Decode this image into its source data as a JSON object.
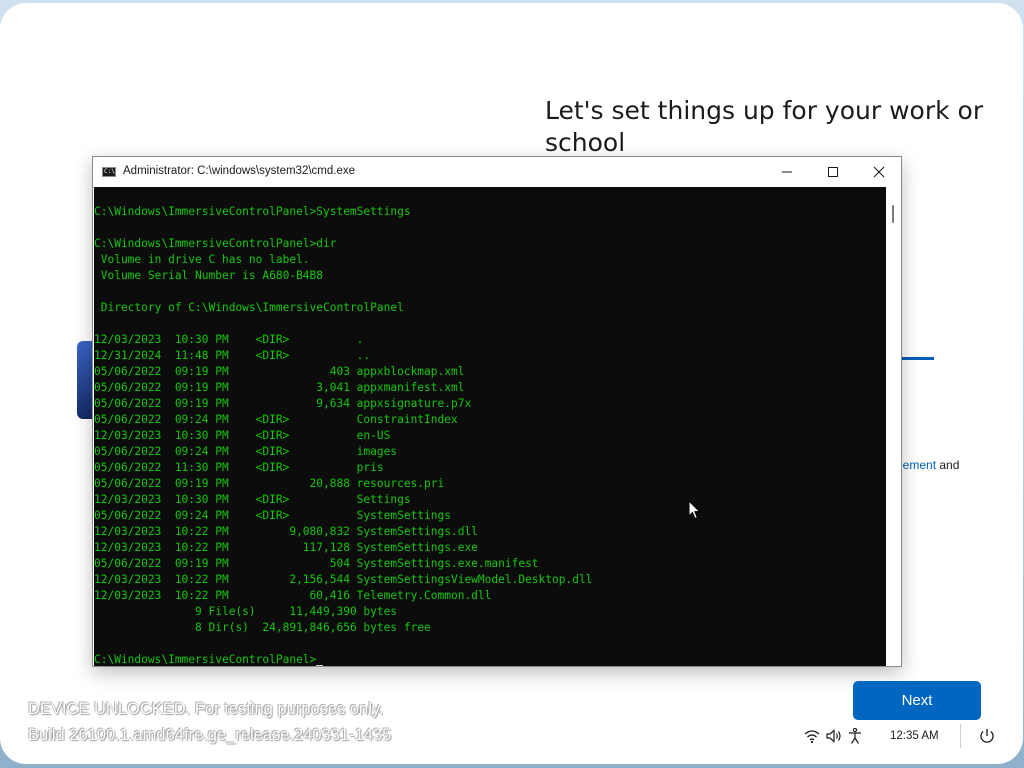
{
  "oobe": {
    "title": "Let's set things up for your work or school",
    "link_fragment_link": "eement",
    "link_fragment_text": " and",
    "next_label": "Next"
  },
  "cmd": {
    "title": "Administrator: C:\\windows\\system32\\cmd.exe",
    "icon_text": "C:\\",
    "lines": [
      "C:\\Windows\\ImmersiveControlPanel>SystemSettings",
      "",
      "C:\\Windows\\ImmersiveControlPanel>dir",
      " Volume in drive C has no label.",
      " Volume Serial Number is A680-B4B8",
      "",
      " Directory of C:\\Windows\\ImmersiveControlPanel",
      "",
      "12/03/2023  10:30 PM    <DIR>          .",
      "12/31/2024  11:48 PM    <DIR>          ..",
      "05/06/2022  09:19 PM               403 appxblockmap.xml",
      "05/06/2022  09:19 PM             3,041 appxmanifest.xml",
      "05/06/2022  09:19 PM             9,634 appxsignature.p7x",
      "05/06/2022  09:24 PM    <DIR>          ConstraintIndex",
      "12/03/2023  10:30 PM    <DIR>          en-US",
      "05/06/2022  09:24 PM    <DIR>          images",
      "05/06/2022  11:30 PM    <DIR>          pris",
      "05/06/2022  09:19 PM            20,888 resources.pri",
      "12/03/2023  10:30 PM    <DIR>          Settings",
      "05/06/2022  09:24 PM    <DIR>          SystemSettings",
      "12/03/2023  10:22 PM         9,080,832 SystemSettings.dll",
      "12/03/2023  10:22 PM           117,128 SystemSettings.exe",
      "05/06/2022  09:19 PM               504 SystemSettings.exe.manifest",
      "12/03/2023  10:22 PM         2,156,544 SystemSettingsViewModel.Desktop.dll",
      "12/03/2023  10:22 PM            60,416 Telemetry.Common.dll",
      "               9 File(s)     11,449,390 bytes",
      "               8 Dir(s)  24,891,846,656 bytes free",
      "",
      "C:\\Windows\\ImmersiveControlPanel>"
    ],
    "text_color": "#16c60c",
    "background": "#0c0c0c"
  },
  "watermark": {
    "line1": "DEVICE UNLOCKED. For testing purposes only.",
    "line2": "Build 26100.1.amd64fre.ge_release.240331-1435"
  },
  "tray": {
    "icons": [
      "wifi-icon",
      "volume-icon",
      "accessibility-icon",
      "power-icon"
    ],
    "time": "12:35 AM"
  },
  "colors": {
    "accent": "#0067c0"
  }
}
